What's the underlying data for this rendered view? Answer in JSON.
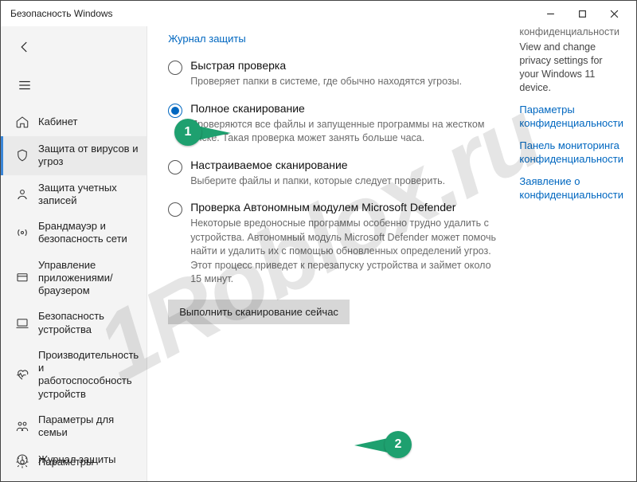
{
  "window": {
    "title": "Безопасность Windows"
  },
  "sidebar": {
    "items": [
      {
        "label": "Кабинет"
      },
      {
        "label": "Защита от вирусов и угроз"
      },
      {
        "label": "Защита учетных записей"
      },
      {
        "label": "Брандмауэр и безопасность сети"
      },
      {
        "label": "Управление приложениями/браузером"
      },
      {
        "label": "Безопасность устройства"
      },
      {
        "label": "Производительность и работоспособность устройств"
      },
      {
        "label": "Параметры для семьи"
      },
      {
        "label": "Журнал защиты"
      }
    ],
    "settings_label": "Параметры"
  },
  "top_link": "Журнал защиты",
  "options": [
    {
      "label": "Быстрая проверка",
      "desc": "Проверяет папки в системе, где обычно находятся угрозы."
    },
    {
      "label": "Полное сканирование",
      "desc": "Проверяются все файлы и запущенные программы на жестком диске. Такая проверка может занять больше часа."
    },
    {
      "label": "Настраиваемое сканирование",
      "desc": "Выберите файлы и папки, которые следует проверить."
    },
    {
      "label": "Проверка Автономным модулем Microsoft Defender",
      "desc": "Некоторые вредоносные программы особенно трудно удалить с устройства. Автономный модуль Microsoft Defender может помочь найти и удалить их с помощью обновленных определений угроз. Этот процесс приведет к перезапуску устройства и займет около 15 минут."
    }
  ],
  "selected_option_index": 1,
  "scan_button": "Выполнить сканирование сейчас",
  "right": {
    "heading": "конфиденциальности",
    "desc": "View and change privacy settings for your Windows 11 device.",
    "links": [
      "Параметры конфиденциальности",
      "Панель мониторинга конфиденциальности",
      "Заявление о конфиденциальности"
    ]
  },
  "annotations": {
    "one": "1",
    "two": "2"
  },
  "watermark": "1Roblox.ru"
}
